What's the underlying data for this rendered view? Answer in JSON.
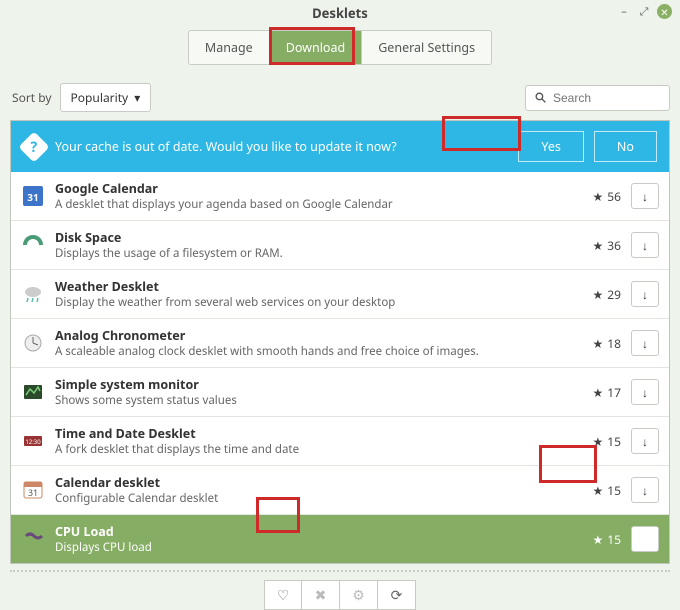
{
  "window": {
    "title": "Desklets"
  },
  "tabs": {
    "manage": "Manage",
    "download": "Download",
    "settings": "General Settings"
  },
  "sort": {
    "label": "Sort by",
    "value": "Popularity"
  },
  "search": {
    "placeholder": "Search"
  },
  "cache": {
    "message": "Your cache is out of date. Would you like to update it now?",
    "yes": "Yes",
    "no": "No"
  },
  "items": [
    {
      "name": "Google Calendar",
      "desc": "A desklet that displays your agenda based on Google Calendar",
      "stars": "56"
    },
    {
      "name": "Disk Space",
      "desc": "Displays the usage of a filesystem or RAM.",
      "stars": "36"
    },
    {
      "name": "Weather Desklet",
      "desc": "Display the weather from several web services on your desktop",
      "stars": "29"
    },
    {
      "name": "Analog Chronometer",
      "desc": "A scaleable analog clock desklet with smooth hands and free choice of images.",
      "stars": "18"
    },
    {
      "name": "Simple system monitor",
      "desc": "Shows some system status values",
      "stars": "17"
    },
    {
      "name": "Time and Date Desklet",
      "desc": "A fork desklet that displays the time and date",
      "stars": "15"
    },
    {
      "name": "Calendar desklet",
      "desc": "Configurable Calendar desklet",
      "stars": "15"
    },
    {
      "name": "CPU Load",
      "desc": "Displays CPU load",
      "stars": "15"
    }
  ]
}
